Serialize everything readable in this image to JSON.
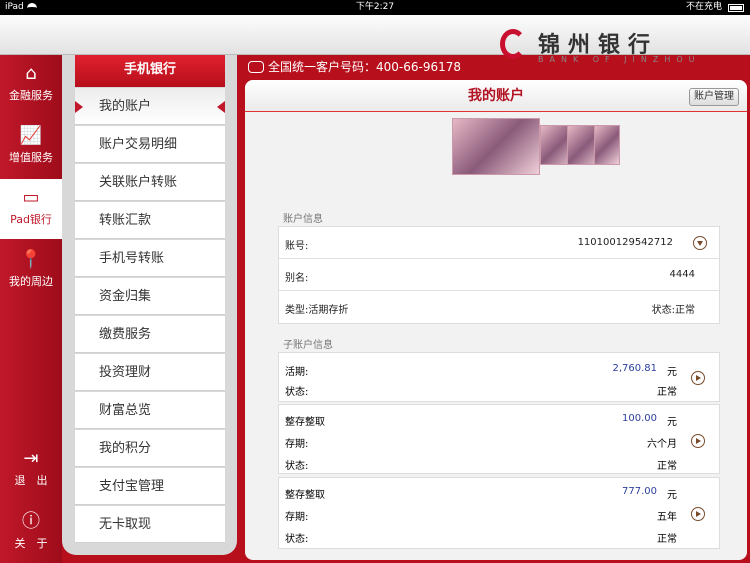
{
  "status": {
    "carrier": "iPad",
    "time": "下午2:27",
    "charging": "不在充电"
  },
  "brand": {
    "name_cn": "锦州银行",
    "name_en": "BANK OF JINZHOU"
  },
  "leftnav": [
    {
      "label": "金融服务",
      "icon": "home-icon"
    },
    {
      "label": "增值服务",
      "icon": "chart-icon"
    },
    {
      "label": "Pad银行",
      "icon": "tablet-icon"
    },
    {
      "label": "我的周边",
      "icon": "location-pin-icon"
    },
    {
      "label": "退　出",
      "icon": "exit-icon"
    },
    {
      "label": "关　于",
      "icon": "info-icon"
    }
  ],
  "menu": {
    "title": "手机银行",
    "items": [
      "我的账户",
      "账户交易明细",
      "关联账户转账",
      "转账汇款",
      "手机号转账",
      "资金归集",
      "缴费服务",
      "投资理财",
      "财富总览",
      "我的积分",
      "支付宝管理",
      "无卡取现"
    ]
  },
  "hotline": "全国统一客户号码：400-66-96178",
  "main": {
    "title": "我的账户",
    "manage_button": "账户管理",
    "account_section": "账户信息",
    "account": {
      "no_label": "账号:",
      "no_value": "110100129542712",
      "alias_label": "别名:",
      "alias_value": "4444",
      "type_label": "类型:活期存折",
      "status_label": "状态:正常"
    },
    "sub_section": "子账户信息",
    "sub": [
      {
        "name": "活期:",
        "amount": "2,760.81",
        "unit": "元",
        "status_label": "状态:",
        "status": "正常"
      },
      {
        "name": "整存整取",
        "amount": "100.00",
        "unit": "元",
        "term_label": "存期:",
        "term": "六个月",
        "status_label": "状态:",
        "status": "正常"
      },
      {
        "name": "整存整取",
        "amount": "777.00",
        "unit": "元",
        "term_label": "存期:",
        "term": "五年",
        "status_label": "状态:",
        "status": "正常"
      }
    ]
  },
  "colors": {
    "brand_red": "#c0182a",
    "amount_blue": "#2b3f9e"
  }
}
